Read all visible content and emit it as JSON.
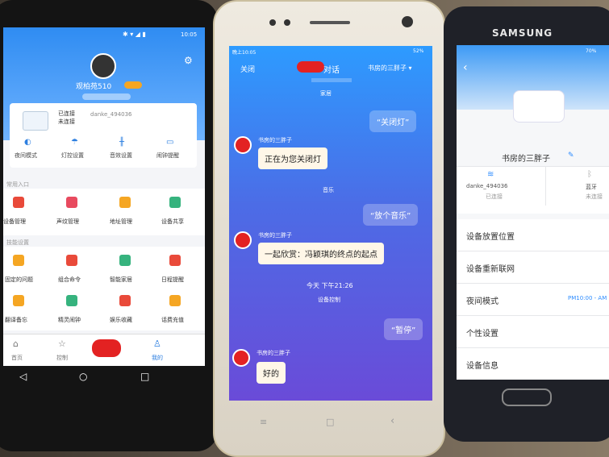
{
  "phone_left": {
    "status_time": "10:05",
    "user_name": "观柏苑510",
    "device_status_connected": "已连接",
    "device_status_disconnected": "未连接",
    "device_id": "danke_494036",
    "quick_controls": [
      "夜间模式",
      "灯控设置",
      "音效设置",
      "闹钟提醒"
    ],
    "section_common_label": "常用入口",
    "common_items": [
      "设备管理",
      "声纹管理",
      "地址管理",
      "设备共享"
    ],
    "section_skills_label": "技能设置",
    "skill_items_row1": [
      "固定的问题",
      "组合命令",
      "智能家居",
      "日程提醒"
    ],
    "skill_items_row2": [
      "翻译备忘",
      "精灵闹钟",
      "娱乐收藏",
      "话费充值"
    ],
    "tabbar": [
      "首页",
      "控制",
      "",
      "我的"
    ],
    "nav_keys": [
      "◁",
      "○",
      "□"
    ]
  },
  "phone_middle": {
    "status_time": "晚上10:05",
    "battery": "52%",
    "close_label": "关闭",
    "title_suffix": "对话",
    "device_selector": "书房的三胖子 ▾",
    "partial_top": "家居",
    "msg_off_light": "“关闭灯”",
    "speaker_name": "书房的三胖子",
    "reply_off_light": "正在为您关闭灯",
    "category_music": "音乐",
    "msg_play_music": "“放个音乐”",
    "reply_music": "一起欣赏：冯颖琪的终点的起点",
    "timestamp": "今天 下午21:26",
    "category_control": "设备控制",
    "msg_pause": "“暂停”",
    "reply_pause": "好的",
    "nav_keys": [
      "≡",
      "□",
      "‹"
    ]
  },
  "phone_right": {
    "brand": "SAMSUNG",
    "battery": "70%",
    "device_name": "书房的三胖子",
    "wifi_name": "danke_494036",
    "wifi_status": "已连接",
    "bt_label": "蓝牙",
    "bt_status": "未连接",
    "settings": [
      "设备放置位置",
      "设备重新联网",
      "夜间模式",
      "个性设置",
      "设备信息"
    ],
    "night_mode_value": "PM10:00 - AM"
  },
  "colors": {
    "accent_blue": "#2d8cff",
    "chat_gradient_top": "#2d9bff",
    "chat_gradient_bottom": "#6a4bd8",
    "redaction": "#e32222"
  }
}
